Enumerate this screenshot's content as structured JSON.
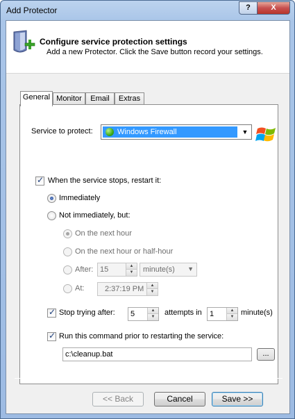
{
  "window": {
    "title": "Add Protector",
    "help_label": "?",
    "close_label": "X"
  },
  "header": {
    "title": "Configure service protection settings",
    "subtitle": "Add a new Protector. Click the Save button record your settings."
  },
  "tabs": [
    {
      "label": "General",
      "active": true
    },
    {
      "label": "Monitor",
      "active": false
    },
    {
      "label": "Email",
      "active": false
    },
    {
      "label": "Extras",
      "active": false
    }
  ],
  "general": {
    "service_label": "Service to protect:",
    "service_value": "Windows Firewall",
    "restart": {
      "label": "When the service stops, restart it:",
      "checked": true,
      "immediately_label": "Immediately",
      "not_immediately_label": "Not immediately, but:",
      "next_hour_label": "On the next hour",
      "next_half_hour_label": "On the next hour or half-hour",
      "after_label": "After:",
      "after_value": "15",
      "after_unit": "minute(s)",
      "at_label": "At:",
      "at_value": "2:37:19 PM"
    },
    "stop_trying": {
      "label": "Stop trying after:",
      "checked": true,
      "attempts_value": "5",
      "attempts_label": "attempts in",
      "minutes_value": "1",
      "minutes_label": "minute(s)"
    },
    "command": {
      "label": "Run this command prior to restarting the service:",
      "checked": true,
      "value": "c:\\cleanup.bat",
      "browse_label": "..."
    }
  },
  "buttons": {
    "back": "<< Back",
    "cancel": "Cancel",
    "save": "Save >>"
  },
  "icons": {
    "header": "shield-add-icon",
    "service": "windows-logo-icon",
    "status": "green-status-icon"
  },
  "colors": {
    "selection": "#3399ff",
    "titlebar": "#a9c5e8",
    "close_button": "#c75050"
  }
}
